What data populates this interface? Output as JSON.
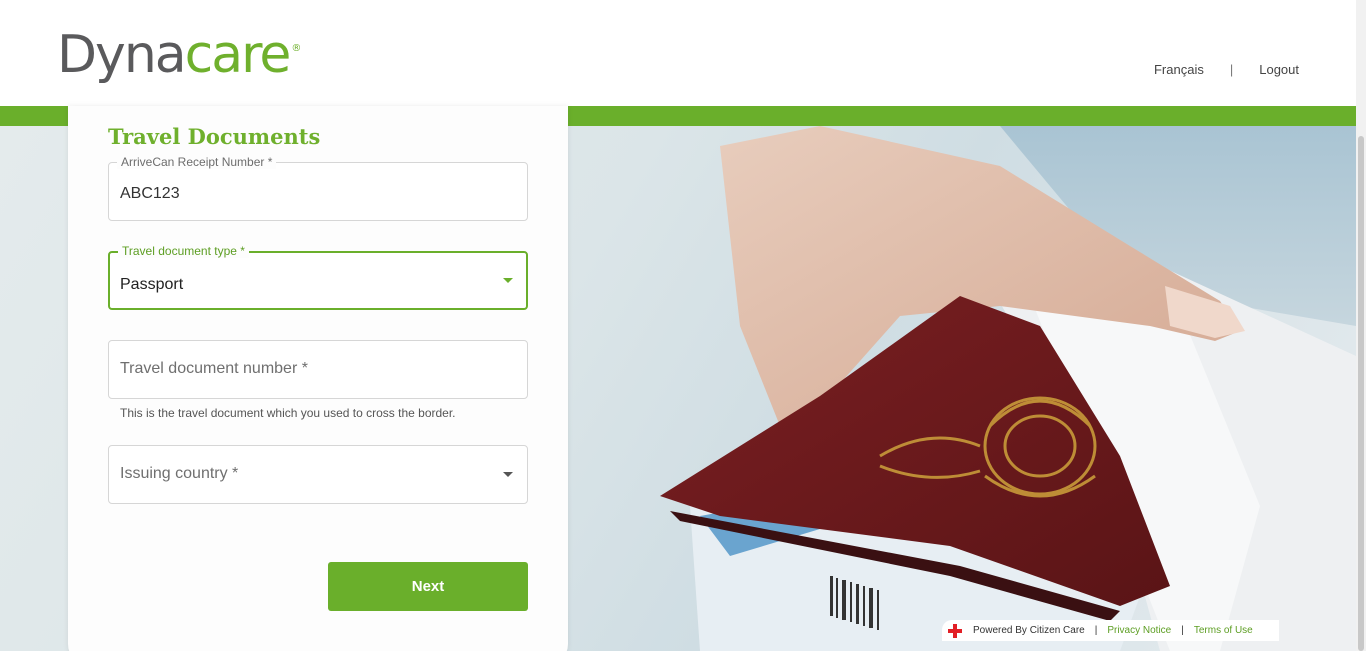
{
  "brand": {
    "name_part1": "Dyna",
    "name_part2": "care",
    "registered": "®"
  },
  "topnav": {
    "language_link": "Français",
    "separator": "|",
    "logout_link": "Logout"
  },
  "form": {
    "title": "Travel Documents",
    "arrivecan": {
      "label": "ArriveCan Receipt Number *",
      "value": "ABC123"
    },
    "document_type": {
      "label": "Travel document type *",
      "value": "Passport"
    },
    "document_number": {
      "placeholder": "Travel document number *",
      "hint": "This is the travel document which you used to cross the border."
    },
    "issuing_country": {
      "placeholder": "Issuing country *"
    },
    "next_label": "Next"
  },
  "footer": {
    "powered_by": "Powered By Citizen Care",
    "separator": "|",
    "privacy": "Privacy Notice",
    "terms": "Terms of Use"
  },
  "colors": {
    "brand_green": "#6aaf2b",
    "brand_gray": "#5a5a5c",
    "red_cross": "#e21f26"
  }
}
